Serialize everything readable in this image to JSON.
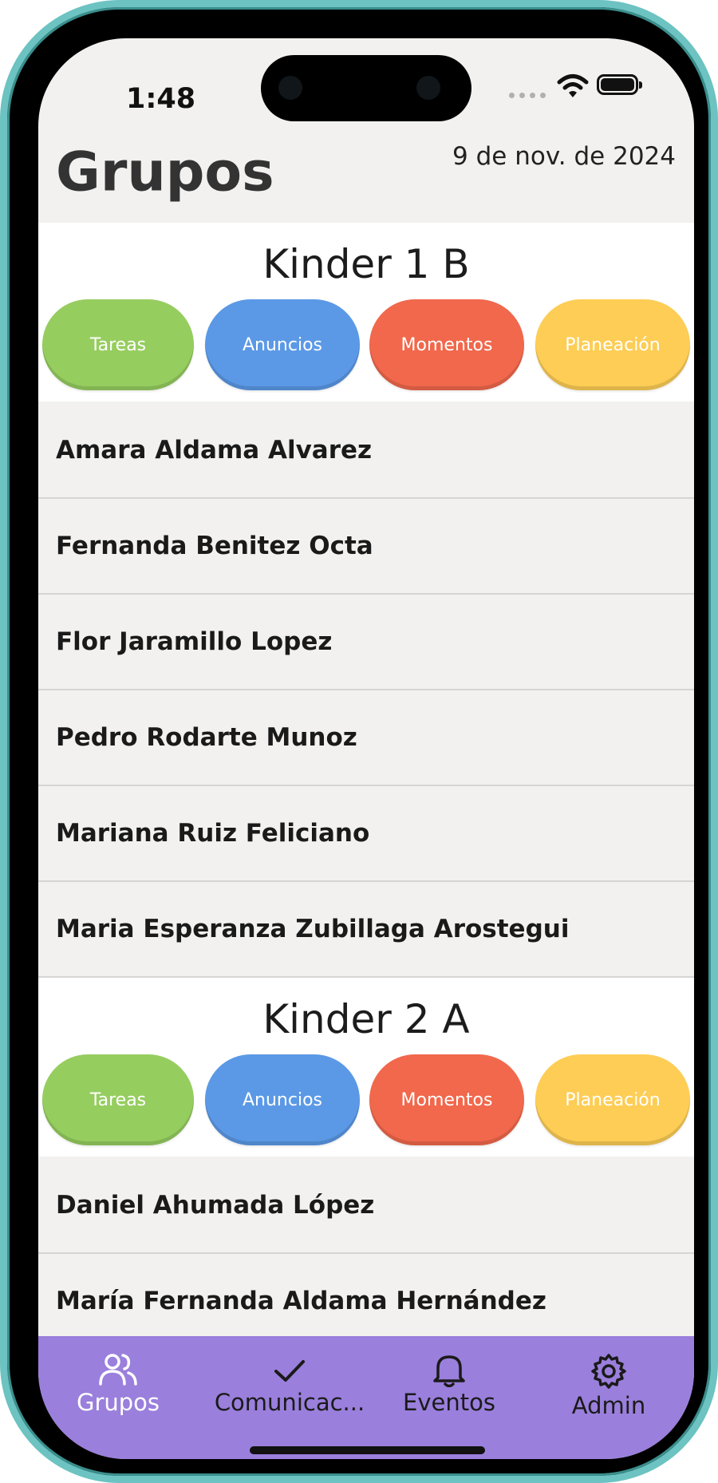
{
  "status_bar": {
    "time": "1:48"
  },
  "header": {
    "title": "Grupos",
    "date": "9 de nov. de 2024"
  },
  "groups": [
    {
      "name": "Kinder 1 B",
      "actions": [
        "Tareas",
        "Anuncios",
        "Momentos",
        "Planeación"
      ],
      "students": [
        "Amara Aldama Alvarez",
        "Fernanda Benitez Octa",
        "Flor Jaramillo Lopez",
        "Pedro Rodarte Munoz",
        "Mariana Ruiz Feliciano",
        "Maria Esperanza Zubillaga Arostegui"
      ]
    },
    {
      "name": "Kinder 2 A",
      "actions": [
        "Tareas",
        "Anuncios",
        "Momentos",
        "Planeación"
      ],
      "students": [
        "Daniel Ahumada López",
        "María Fernanda Aldama Hernández"
      ]
    }
  ],
  "action_colors": {
    "Tareas": "#96cd5f",
    "Anuncios": "#5b99e6",
    "Momentos": "#f1684c",
    "Planeación": "#fdcd55"
  },
  "tab_bar": {
    "background": "#9a7fdc",
    "active_tab": "Grupos",
    "tabs": [
      {
        "label": "Grupos",
        "icon": "users-icon"
      },
      {
        "label": "Comunicac...",
        "icon": "checkmark-icon"
      },
      {
        "label": "Eventos",
        "icon": "bell-icon"
      },
      {
        "label": "Admin",
        "icon": "gear-icon"
      }
    ]
  }
}
